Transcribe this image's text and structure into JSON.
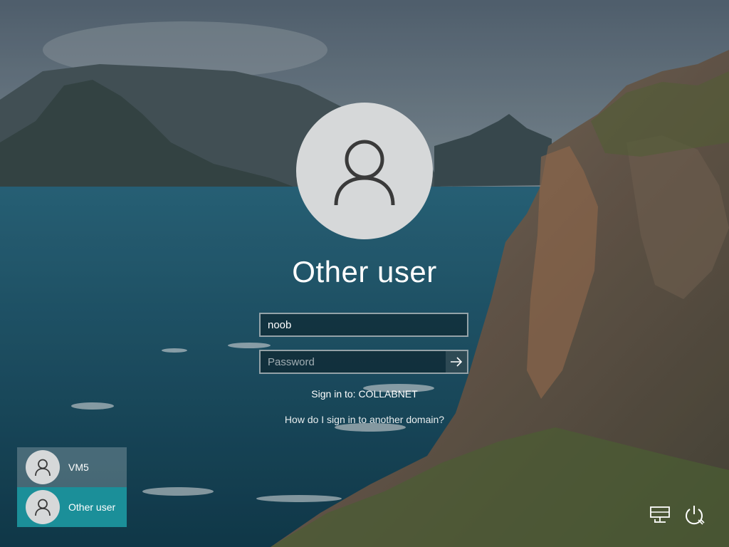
{
  "login": {
    "display_name": "Other user",
    "username_value": "noob",
    "password_placeholder": "Password",
    "sign_in_to": "Sign in to: COLLABNET",
    "help_link": "How do I sign in to another domain?"
  },
  "user_list": {
    "items": [
      {
        "label": "VM5",
        "selected": false
      },
      {
        "label": "Other user",
        "selected": true
      }
    ]
  },
  "icons": {
    "avatar": "user-silhouette-icon",
    "submit": "arrow-right-icon",
    "network": "network-icon",
    "power": "power-icon"
  },
  "colors": {
    "selected_tile": "#1b8f99",
    "avatar_bg": "#d6d8d9"
  }
}
